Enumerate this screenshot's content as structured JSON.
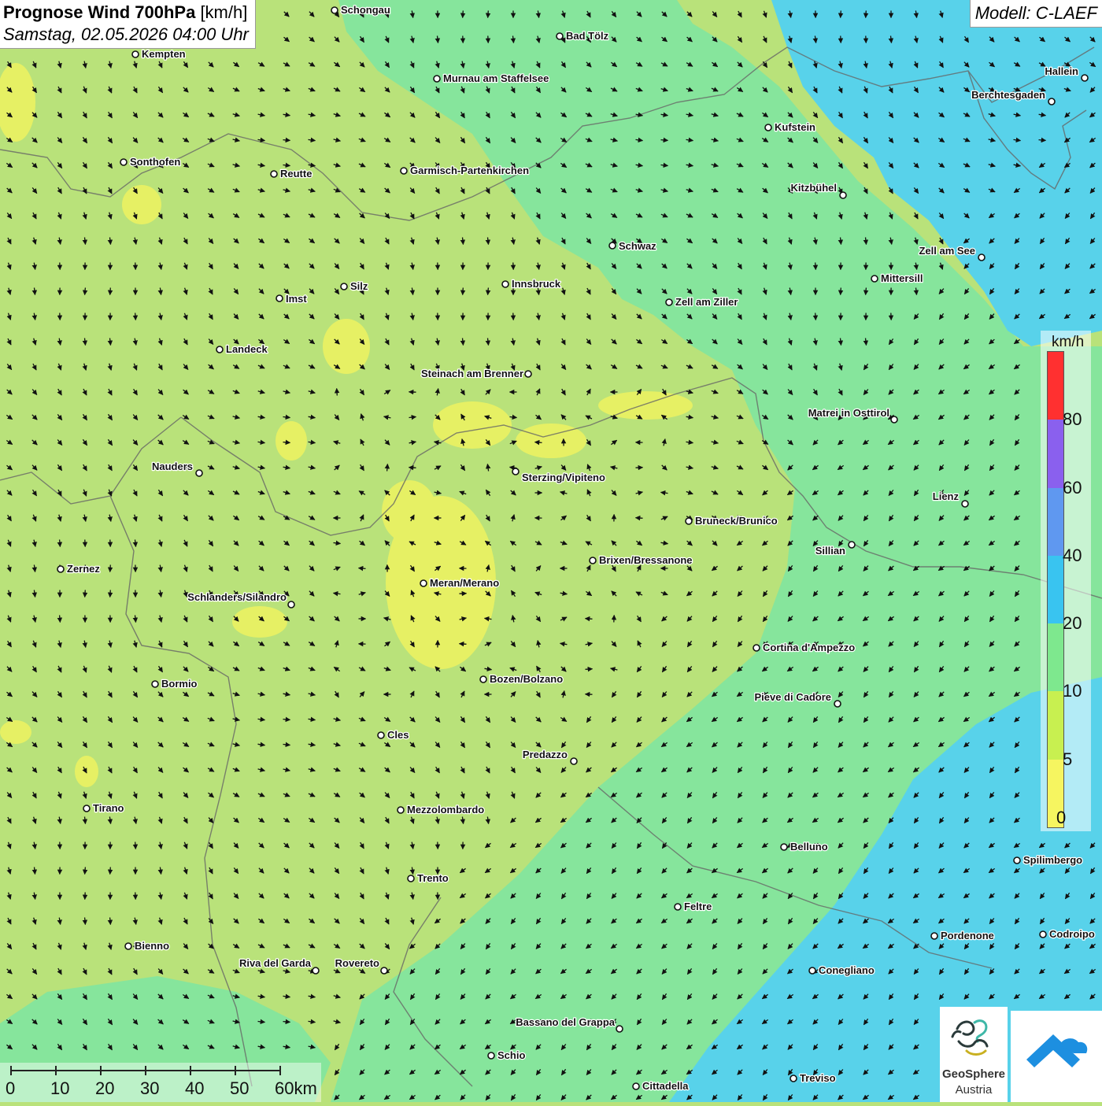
{
  "title": {
    "bold": "Prognose Wind 700hPa",
    "unit": "[km/h]",
    "subtitle": "Samstag, 02.05.2026 04:00 Uhr"
  },
  "model": "Modell: C-LAEF",
  "legend": {
    "unit": "km/h",
    "ticks": [
      "80",
      "60",
      "40",
      "20",
      "10",
      "5",
      "0"
    ],
    "colors": [
      "#ff3030",
      "#8a60ee",
      "#5f98f0",
      "#39c4f0",
      "#7ee88e",
      "#c8f050",
      "#f6f560"
    ]
  },
  "colors": {
    "calm": "#e6f064",
    "light": "#b9e27a",
    "moderate": "#86e59c",
    "fresh": "#58d2ea"
  },
  "scale_labels": [
    "0",
    "10",
    "20",
    "30",
    "40",
    "50",
    "60km"
  ],
  "logo": {
    "name": "GeoSphere",
    "country": "Austria"
  },
  "icons": [
    "geosphere-logo-icon",
    "app-logo-icon",
    "city-marker-icon",
    "wind-arrow-icon"
  ],
  "cities": [
    {
      "name": "Schongau"
    },
    {
      "name": "Kempten"
    },
    {
      "name": "Bad Tölz"
    },
    {
      "name": "Murnau am Staffelsee"
    },
    {
      "name": "Hallein"
    },
    {
      "name": "Berchtesgaden"
    },
    {
      "name": "Kufstein"
    },
    {
      "name": "Sonthofen"
    },
    {
      "name": "Reutte"
    },
    {
      "name": "Garmisch-Partenkirchen"
    },
    {
      "name": "Kitzbühel"
    },
    {
      "name": "Schwaz"
    },
    {
      "name": "Zell am See"
    },
    {
      "name": "Mittersill"
    },
    {
      "name": "Imst"
    },
    {
      "name": "Silz"
    },
    {
      "name": "Innsbruck"
    },
    {
      "name": "Zell am Ziller"
    },
    {
      "name": "Landeck"
    },
    {
      "name": "Steinach am Brenner"
    },
    {
      "name": "Matrei in Osttirol"
    },
    {
      "name": "Nauders"
    },
    {
      "name": "Sterzing/Vipiteno"
    },
    {
      "name": "Lienz"
    },
    {
      "name": "Bruneck/Brunico"
    },
    {
      "name": "Sillian"
    },
    {
      "name": "Brixen/Bressanone"
    },
    {
      "name": "Zernez"
    },
    {
      "name": "Meran/Merano"
    },
    {
      "name": "Schlanders/Silandro"
    },
    {
      "name": "Cortina d'Ampezzo"
    },
    {
      "name": "Bozen/Bolzano"
    },
    {
      "name": "Bormio"
    },
    {
      "name": "Pieve di Cadore"
    },
    {
      "name": "Cles"
    },
    {
      "name": "Predazzo"
    },
    {
      "name": "Tirano"
    },
    {
      "name": "Mezzolombardo"
    },
    {
      "name": "Belluno"
    },
    {
      "name": "Spilimbergo"
    },
    {
      "name": "Trento"
    },
    {
      "name": "Feltre"
    },
    {
      "name": "Pordenone"
    },
    {
      "name": "Codroipo"
    },
    {
      "name": "Bienno"
    },
    {
      "name": "Riva del Garda"
    },
    {
      "name": "Rovereto"
    },
    {
      "name": "Conegliano"
    },
    {
      "name": "Bassano del Grappa"
    },
    {
      "name": "Schio"
    },
    {
      "name": "Treviso"
    },
    {
      "name": "Cittadella"
    }
  ]
}
